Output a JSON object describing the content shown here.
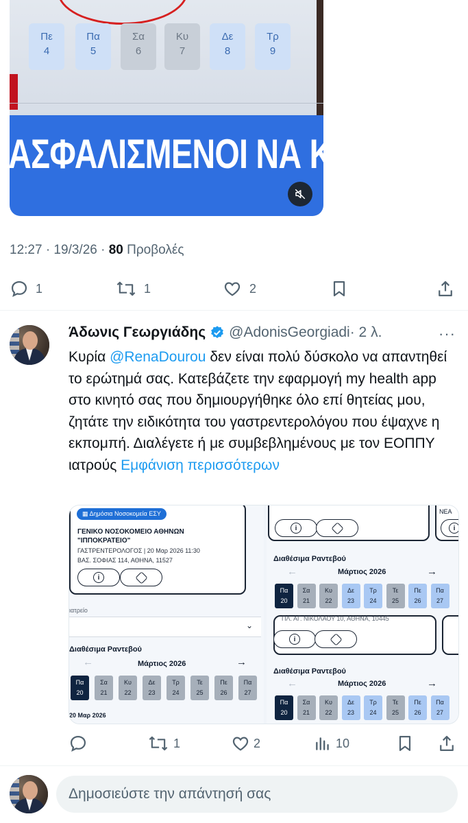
{
  "video": {
    "days": [
      {
        "dow": "Πε",
        "num": "4"
      },
      {
        "dow": "Πα",
        "num": "5"
      },
      {
        "dow": "Σα",
        "num": "6"
      },
      {
        "dow": "Κυ",
        "num": "7"
      },
      {
        "dow": "Δε",
        "num": "8"
      },
      {
        "dow": "Τρ",
        "num": "9"
      }
    ],
    "banner_text": "ΑΣΦΑΛΙΣΜΕΝΟΙ ΝΑ ΚΛ",
    "mute_icon": "mute-icon"
  },
  "tweet_meta": {
    "time": "12:27 · 19/3/26 · ",
    "views_count": "80",
    "views_label": " Προβολές"
  },
  "tweet_actions": {
    "replies": "1",
    "reposts": "1",
    "likes": "2"
  },
  "reply": {
    "name": "Άδωνις Γεωργιάδης",
    "handle": "@AdonisGeorgiadi",
    "time": " · 2 λ.",
    "more": "···",
    "text_1": "Κυρία ",
    "mention": "@RenaDourou",
    "text_2": " δεν είναι πολύ δύσκολο να απαντηθεί το ερώτημά σας. Κατεβάζετε την εφαρμογή my health app στο κινητό σας που δημιουργήθηκε όλο επί θητείας μου, ζητάτε την ειδικότητα του γαστρεντερολόγου που έψαχνε η εκπομπή. Διαλέγετε ή με συμβεβλημένους με τον ΕΟΠΠΥ ιατρούς ",
    "show_more": "Εμφάνιση περισσότερων",
    "actions": {
      "replies": "",
      "reposts": "1",
      "likes": "2",
      "views": "10"
    }
  },
  "screenshot": {
    "left": {
      "badge": "Δημόσια Νοσοκομεία ΕΣΥ",
      "hospital_line1": "ΓΕΝΙΚΟ ΝΟΣΟΚΟΜΕΙΟ ΑΘΗΝΩΝ",
      "hospital_line2": "\"ΙΠΠΟΚΡΑΤΕΙΟ\"",
      "specialty": "ΓΑΣΤΡΕΝΤΕΡΟΛΟΓΟΣ | 20 Μαρ 2026 11:30",
      "address": "ΒΑΣ. ΣΟΦΙΑΣ 114, ΑΘΗΝΑ, 11527",
      "dropdown_label": "ιατρείο",
      "section": "Διαθέσιμα Ραντεβού",
      "month": "Μάρτιος 2026",
      "footer_date": "20 Μαρ 2026",
      "days": [
        {
          "dow": "Πα",
          "num": "20"
        },
        {
          "dow": "Σα",
          "num": "21"
        },
        {
          "dow": "Κυ",
          "num": "22"
        },
        {
          "dow": "Δε",
          "num": "23"
        },
        {
          "dow": "Τρ",
          "num": "24"
        },
        {
          "dow": "Τε",
          "num": "25"
        },
        {
          "dow": "Πε",
          "num": "26"
        },
        {
          "dow": "Πα",
          "num": "27"
        }
      ]
    },
    "right": {
      "top_text": "ΝΕΑ",
      "address_partial": "ΠΛ. ΑΓ. ΝΙΚΟΛΑΟΥ 10, ΑΘΗΝΑ, 10445",
      "section_1": "Διαθέσιμα Ραντεβού",
      "month_1": "Μάρτιος 2026",
      "section_2": "Διαθέσιμα Ραντεβού",
      "month_2": "Μάρτιος 2026",
      "days": [
        {
          "dow": "Πα",
          "num": "20"
        },
        {
          "dow": "Σα",
          "num": "21"
        },
        {
          "dow": "Κυ",
          "num": "22"
        },
        {
          "dow": "Δε",
          "num": "23"
        },
        {
          "dow": "Τρ",
          "num": "24"
        },
        {
          "dow": "Τε",
          "num": "25"
        },
        {
          "dow": "Πε",
          "num": "26"
        },
        {
          "dow": "Πα",
          "num": "27"
        }
      ]
    }
  },
  "compose": {
    "placeholder": "Δημοσιεύστε την απάντησή σας"
  },
  "colors": {
    "accent": "#1d9bf0",
    "muted": "#536471",
    "banner_blue": "#2f6fe0"
  }
}
